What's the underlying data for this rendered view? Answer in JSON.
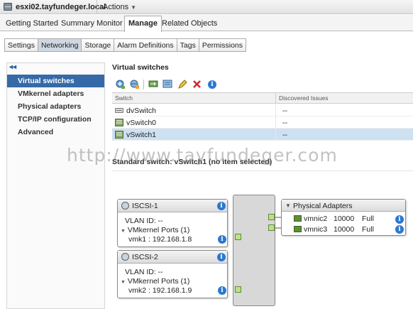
{
  "header": {
    "host_name": "esxi02.tayfundeger.local",
    "actions_label": "Actions",
    "actions_caret": "▼"
  },
  "main_tabs": [
    {
      "label": "Getting Started"
    },
    {
      "label": "Summary"
    },
    {
      "label": "Monitor"
    },
    {
      "label": "Manage",
      "active": true
    },
    {
      "label": "Related Objects"
    }
  ],
  "sub_tabs": [
    {
      "label": "Settings"
    },
    {
      "label": "Networking",
      "active": true
    },
    {
      "label": "Storage"
    },
    {
      "label": "Alarm Definitions"
    },
    {
      "label": "Tags"
    },
    {
      "label": "Permissions"
    }
  ],
  "left_nav": {
    "collapse_label": "◂◂",
    "items": [
      {
        "label": "Virtual switches",
        "active": true
      },
      {
        "label": "VMkernel adapters"
      },
      {
        "label": "Physical adapters"
      },
      {
        "label": "TCP/IP configuration"
      },
      {
        "label": "Advanced"
      }
    ]
  },
  "virtual_switches": {
    "title": "Virtual switches",
    "columns": [
      "Switch",
      "Discovered Issues"
    ],
    "rows": [
      {
        "name": "dvSwitch",
        "issues": "--"
      },
      {
        "name": "vSwitch0",
        "issues": "--"
      },
      {
        "name": "vSwitch1",
        "issues": "--",
        "selected": true
      }
    ]
  },
  "watermark": "http://www.tayfundeger.com",
  "standard_switch_label": "Standard switch: vSwitch1 (no item selected)",
  "port_groups": [
    {
      "name": "ISCSI-1",
      "vlan": "VLAN ID: --",
      "ports_label": "VMkernel Ports (1)",
      "vmk": "vmk1 : 192.168.1.8"
    },
    {
      "name": "ISCSI-2",
      "vlan": "VLAN ID: --",
      "ports_label": "VMkernel Ports (1)",
      "vmk": "vmk2 : 192.168.1.9"
    }
  ],
  "physical_adapters": {
    "title": "Physical Adapters",
    "nics": [
      {
        "name": "vmnic2",
        "speed": "10000",
        "duplex": "Full"
      },
      {
        "name": "vmnic3",
        "speed": "10000",
        "duplex": "Full"
      }
    ]
  },
  "icons": {
    "info": "i",
    "tri_down": "▼",
    "toolbar": [
      "add-host-networking-icon",
      "add-network-icon",
      "migrate-icon",
      "manage-physical-adapters-icon",
      "edit-pencil-icon",
      "remove-red-x-icon",
      "info-icon"
    ]
  },
  "colors": {
    "accent": "#356aa7",
    "selected_row": "#cde1f3",
    "info_blue": "#2b78d0",
    "nic_green": "#5e8e39",
    "remove_red": "#d0262c"
  }
}
